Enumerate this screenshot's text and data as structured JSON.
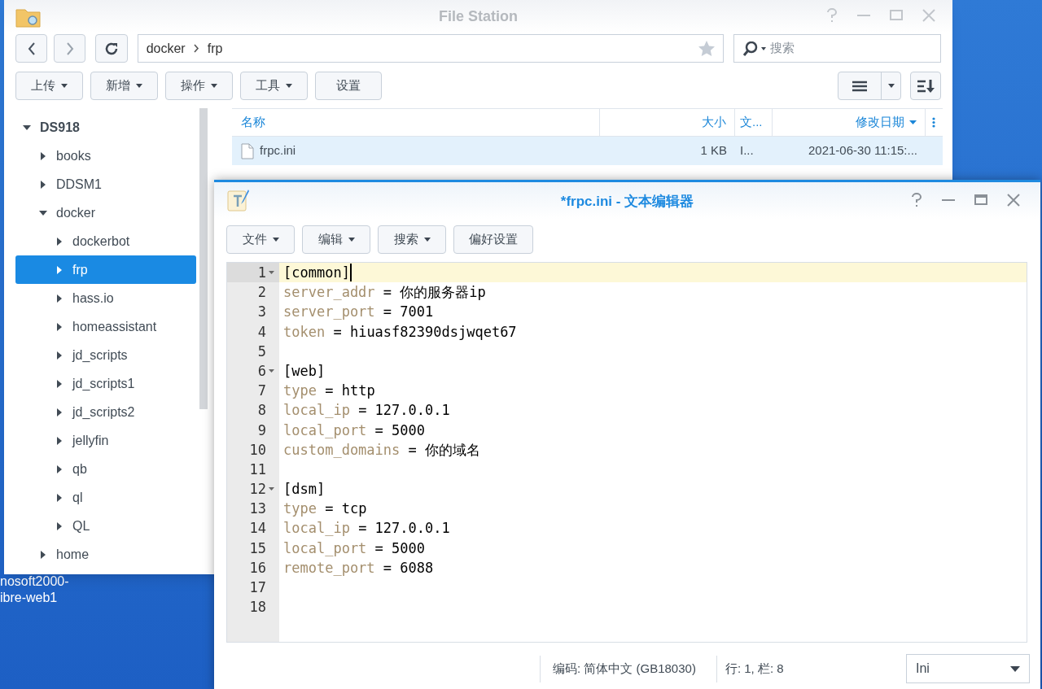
{
  "desktop": {
    "icon_labels": [
      "nosoft2000-",
      "ibre-web1"
    ]
  },
  "file_station": {
    "title": "File Station",
    "path": [
      "docker",
      "frp"
    ],
    "search": {
      "placeholder": "搜索"
    },
    "toolbar": [
      {
        "label": "上传",
        "dropdown": true
      },
      {
        "label": "新增",
        "dropdown": true
      },
      {
        "label": "操作",
        "dropdown": true
      },
      {
        "label": "工具",
        "dropdown": true
      },
      {
        "label": "设置",
        "dropdown": false
      }
    ],
    "tree": [
      {
        "label": "DS918",
        "expanded": true,
        "selected": false,
        "children": [
          {
            "label": "books",
            "expanded": false,
            "selected": false
          },
          {
            "label": "DDSM1",
            "expanded": false,
            "selected": false
          },
          {
            "label": "docker",
            "expanded": true,
            "selected": false,
            "children": [
              {
                "label": "dockerbot",
                "expanded": false,
                "selected": false
              },
              {
                "label": "frp",
                "expanded": false,
                "selected": true
              },
              {
                "label": "hass.io",
                "expanded": false,
                "selected": false
              },
              {
                "label": "homeassistant",
                "expanded": false,
                "selected": false
              },
              {
                "label": "jd_scripts",
                "expanded": false,
                "selected": false
              },
              {
                "label": "jd_scripts1",
                "expanded": false,
                "selected": false
              },
              {
                "label": "jd_scripts2",
                "expanded": false,
                "selected": false
              },
              {
                "label": "jellyfin",
                "expanded": false,
                "selected": false
              },
              {
                "label": "qb",
                "expanded": false,
                "selected": false
              },
              {
                "label": "ql",
                "expanded": false,
                "selected": false
              },
              {
                "label": "QL",
                "expanded": false,
                "selected": false
              }
            ]
          },
          {
            "label": "home",
            "expanded": false,
            "selected": false
          }
        ]
      }
    ],
    "table": {
      "columns": [
        "名称",
        "大小",
        "文...",
        "修改日期"
      ],
      "rows": [
        {
          "cells": [
            "frpc.ini",
            "1 KB",
            "I...",
            "2021-06-30 11:15:..."
          ],
          "selected": true
        }
      ]
    }
  },
  "editor": {
    "title": "*frpc.ini - 文本编辑器",
    "toolbar": [
      {
        "label": "文件",
        "dropdown": true
      },
      {
        "label": "编辑",
        "dropdown": true
      },
      {
        "label": "搜索",
        "dropdown": true
      },
      {
        "label": "偏好设置",
        "dropdown": false
      }
    ],
    "lines": [
      {
        "number": "1",
        "kind": "section",
        "text": "[common]",
        "foldable": true,
        "active": true
      },
      {
        "number": "2",
        "kind": "pair",
        "key": "server_addr",
        "operator": "=",
        "value": "你的服务器ip",
        "foldable": false,
        "active": false
      },
      {
        "number": "3",
        "kind": "pair",
        "key": "server_port",
        "operator": "=",
        "value": "7001",
        "foldable": false,
        "active": false
      },
      {
        "number": "4",
        "kind": "pair",
        "key": "token",
        "operator": "=",
        "value": "hiuasf82390dsjwqet67",
        "foldable": false,
        "active": false
      },
      {
        "number": "5",
        "kind": "blank",
        "foldable": false,
        "active": false
      },
      {
        "number": "6",
        "kind": "section",
        "text": "[web]",
        "foldable": true,
        "active": false
      },
      {
        "number": "7",
        "kind": "pair",
        "key": "type",
        "operator": "=",
        "value": "http",
        "foldable": false,
        "active": false
      },
      {
        "number": "8",
        "kind": "pair",
        "key": "local_ip",
        "operator": "=",
        "value": "127.0.0.1",
        "foldable": false,
        "active": false
      },
      {
        "number": "9",
        "kind": "pair",
        "key": "local_port",
        "operator": "=",
        "value": "5000",
        "foldable": false,
        "active": false
      },
      {
        "number": "10",
        "kind": "pair",
        "key": "custom_domains",
        "operator": "=",
        "value": "你的域名",
        "foldable": false,
        "active": false
      },
      {
        "number": "11",
        "kind": "blank",
        "foldable": false,
        "active": false
      },
      {
        "number": "12",
        "kind": "section",
        "text": "[dsm]",
        "foldable": true,
        "active": false
      },
      {
        "number": "13",
        "kind": "pair",
        "key": "type",
        "operator": "=",
        "value": "tcp",
        "foldable": false,
        "active": false
      },
      {
        "number": "14",
        "kind": "pair",
        "key": "local_ip",
        "operator": "=",
        "value": "127.0.0.1",
        "foldable": false,
        "active": false
      },
      {
        "number": "15",
        "kind": "pair",
        "key": "local_port",
        "operator": "=",
        "value": "5000",
        "foldable": false,
        "active": false
      },
      {
        "number": "16",
        "kind": "pair",
        "key": "remote_port",
        "operator": "=",
        "value": "6088",
        "foldable": false,
        "active": false
      },
      {
        "number": "17",
        "kind": "blank",
        "foldable": false,
        "active": false
      },
      {
        "number": "18",
        "kind": "blank",
        "foldable": false,
        "active": false
      }
    ],
    "status": {
      "encoding": "编码: 简体中文 (GB18030)",
      "position": "行: 1, 栏: 8",
      "language": "Ini"
    }
  }
}
